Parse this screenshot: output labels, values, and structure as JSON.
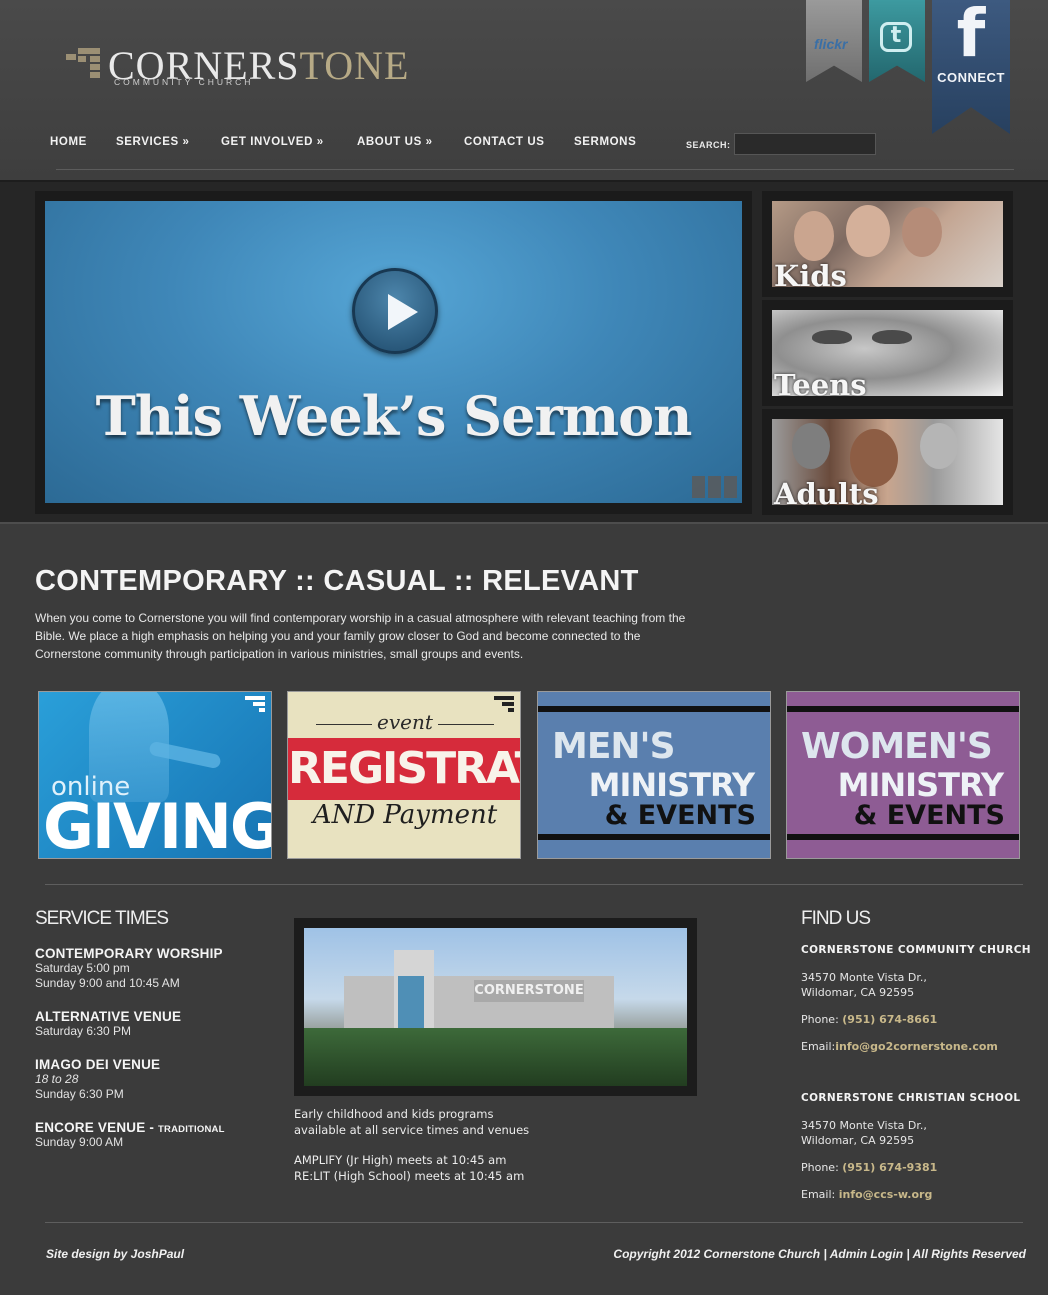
{
  "brand": {
    "name_main": "CORNERS",
    "name_tail": "TONE",
    "subtitle": "COMMUNITY CHURCH"
  },
  "social": {
    "flickr_label": "flickr",
    "twitter_glyph": "t",
    "facebook_glyph": "f",
    "facebook_connect": "CONNECT",
    "colors": {
      "flickr": "#808080",
      "twitter": "#2f818a",
      "facebook": "#32496b"
    }
  },
  "nav": {
    "items": [
      {
        "label": "HOME"
      },
      {
        "label": "SERVICES »"
      },
      {
        "label": "GET INVOLVED »"
      },
      {
        "label": "ABOUT US »"
      },
      {
        "label": "CONTACT US"
      },
      {
        "label": "SERMONS"
      }
    ],
    "search_label": "SEARCH:",
    "search_value": ""
  },
  "hero": {
    "title": "This Week’s Sermon",
    "play_icon": "play-icon"
  },
  "side_cards": [
    {
      "label": "Kids"
    },
    {
      "label": "Teens"
    },
    {
      "label": "Adults"
    }
  ],
  "intro": {
    "title": "CONTEMPORARY :: CASUAL :: RELEVANT",
    "text": "When you come to Cornerstone you will find contemporary worship in a casual atmosphere with relevant teaching from the Bible. We place a high emphasis on helping you and your family grow closer to God and become connected to the Cornerstone community through participation in various ministries, small groups and events."
  },
  "tiles": {
    "giving": {
      "small": "online",
      "big": "GIVING"
    },
    "registration": {
      "event": "event",
      "band": "REGISTRATION",
      "and": "AND Payment"
    },
    "men": {
      "line1": "MEN'S",
      "line2": "MINISTRY",
      "line3": "& EVENTS"
    },
    "women": {
      "line1": "WOMEN'S",
      "line2": "MINISTRY",
      "line3": "& EVENTS"
    }
  },
  "service_times": {
    "title": "SERVICE TIMES",
    "items": [
      {
        "name": "CONTEMPORARY WORSHIP",
        "lines": [
          "Saturday 5:00 pm",
          "Sunday 9:00 and 10:45 AM"
        ]
      },
      {
        "name": "ALTERNATIVE VENUE",
        "lines": [
          "Saturday 6:30 PM"
        ]
      },
      {
        "name": "IMAGO DEI VENUE",
        "lines": [
          "18 to 28",
          "Sunday 6:30 PM"
        ]
      },
      {
        "name": "ENCORE VENUE - ",
        "name_small": "TRADITIONAL",
        "lines": [
          "Sunday 9:00 AM"
        ]
      }
    ]
  },
  "church_photo": {
    "sign_text": "CORNERSTONE",
    "caption_1": "Early childhood and kids programs",
    "caption_2": "available at all service times and venues",
    "caption_3": "AMPLIFY (Jr High) meets at 10:45 am",
    "caption_4": "RE:LIT (High School) meets at 10:45 am"
  },
  "find_us": {
    "title": "FIND US",
    "church": {
      "name": "CORNERSTONE COMMUNITY CHURCH",
      "address_1": "34570 Monte Vista Dr.,",
      "address_2": "Wildomar, CA 92595",
      "phone_label": "Phone: ",
      "phone": "(951) 674-8661",
      "email_label": "Email:",
      "email": "info@go2cornerstone.com"
    },
    "school": {
      "name": "CORNERSTONE CHRISTIAN SCHOOL",
      "address_1": "34570 Monte Vista Dr.,",
      "address_2": "Wildomar, CA 92595",
      "phone_label": "Phone: ",
      "phone": "(951) 674-9381",
      "email_label": "Email: ",
      "email": "info@ccs-w.org"
    },
    "accent_color": "#c8b88a"
  },
  "footer": {
    "credit": "Site design by JoshPaul",
    "copyright": "Copyright 2012 Cornerstone Church | ",
    "admin_login": "Admin Login",
    "separator": " | ",
    "rights": "All Rights Reserved"
  }
}
